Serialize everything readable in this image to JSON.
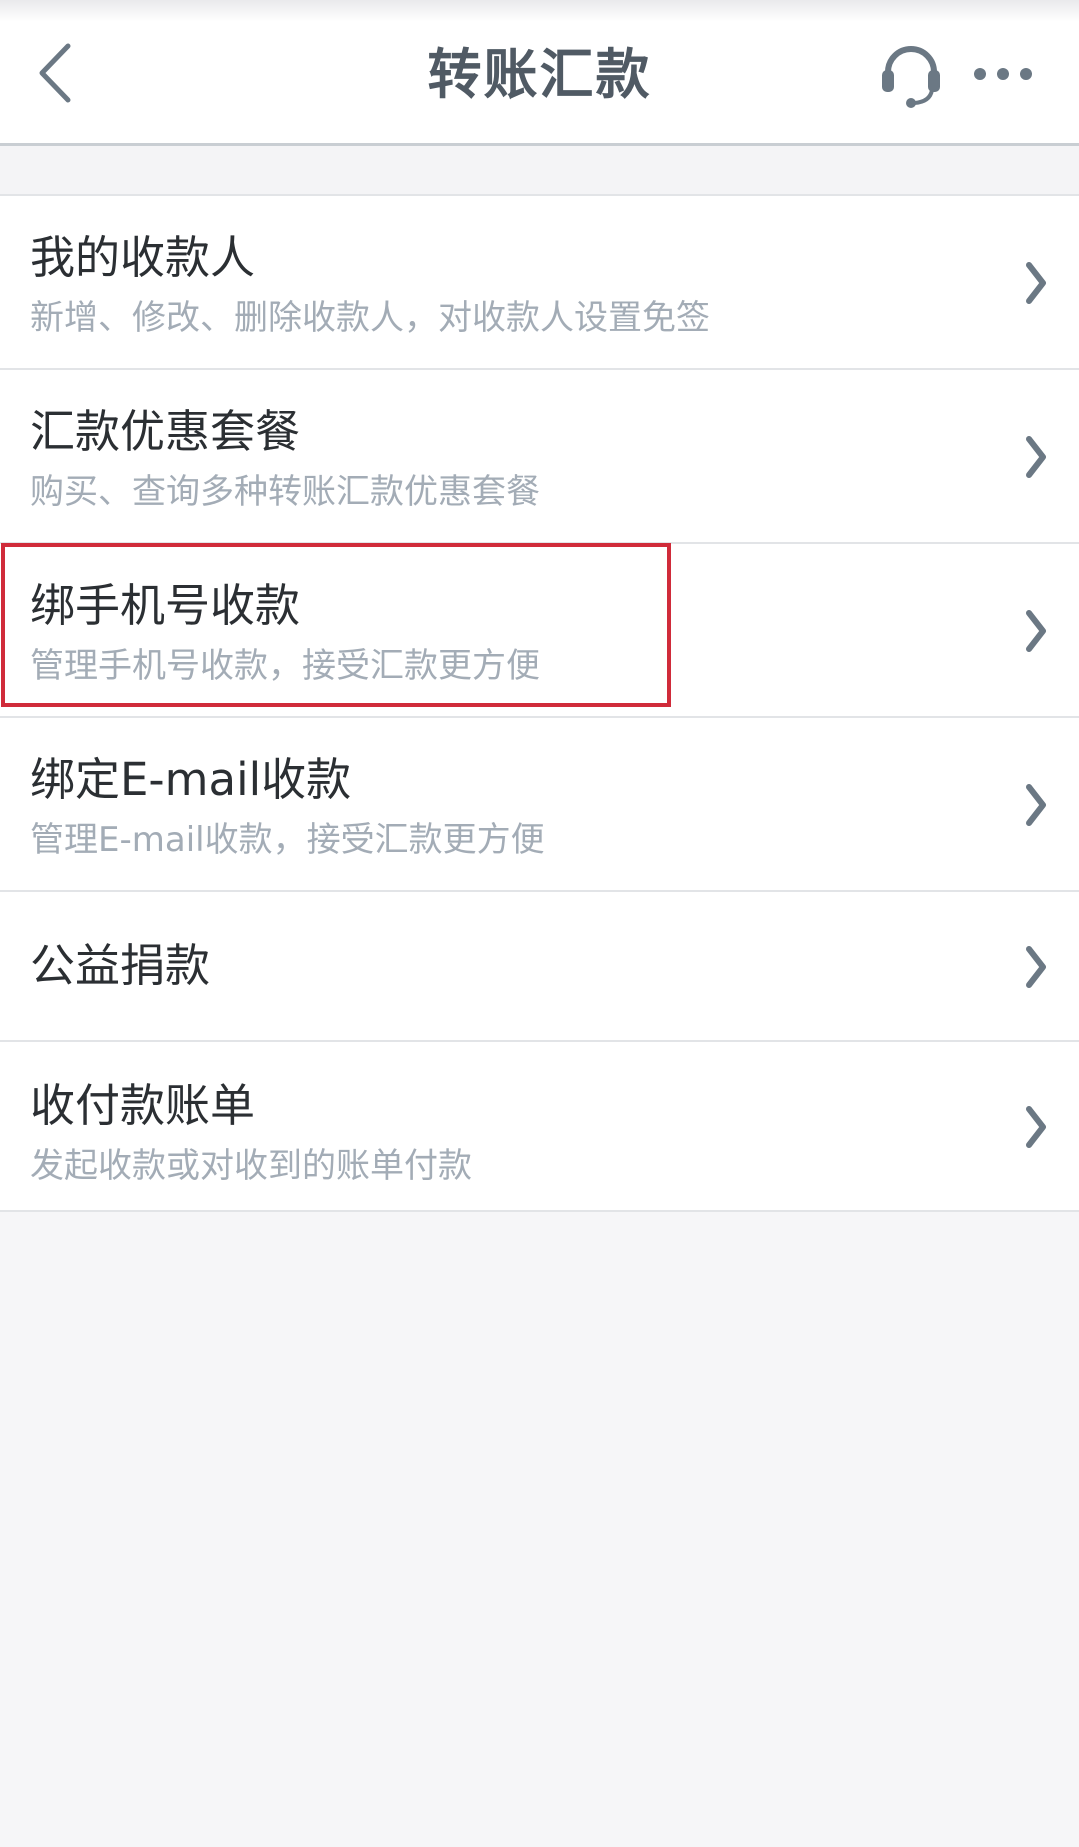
{
  "header": {
    "title": "转账汇款",
    "back_icon": "chevron-left-icon",
    "support_icon": "headset-icon",
    "more_icon": "more-dots-icon"
  },
  "menu": {
    "items": [
      {
        "title": "我的收款人",
        "subtitle": "新增、修改、删除收款人，对收款人设置免签"
      },
      {
        "title": "汇款优惠套餐",
        "subtitle": "购买、查询多种转账汇款优惠套餐"
      },
      {
        "title": "绑手机号收款",
        "subtitle": "管理手机号收款，接受汇款更方便"
      },
      {
        "title": "绑定E-mail收款",
        "subtitle": "管理E-mail收款，接受汇款更方便"
      },
      {
        "title": "公益捐款"
      },
      {
        "title": "收付款账单",
        "subtitle": "发起收款或对收到的账单付款"
      }
    ]
  },
  "colors": {
    "highlight_border": "#d02b3a",
    "title_text": "#505a64",
    "subtitle_text": "#a3acb6"
  }
}
